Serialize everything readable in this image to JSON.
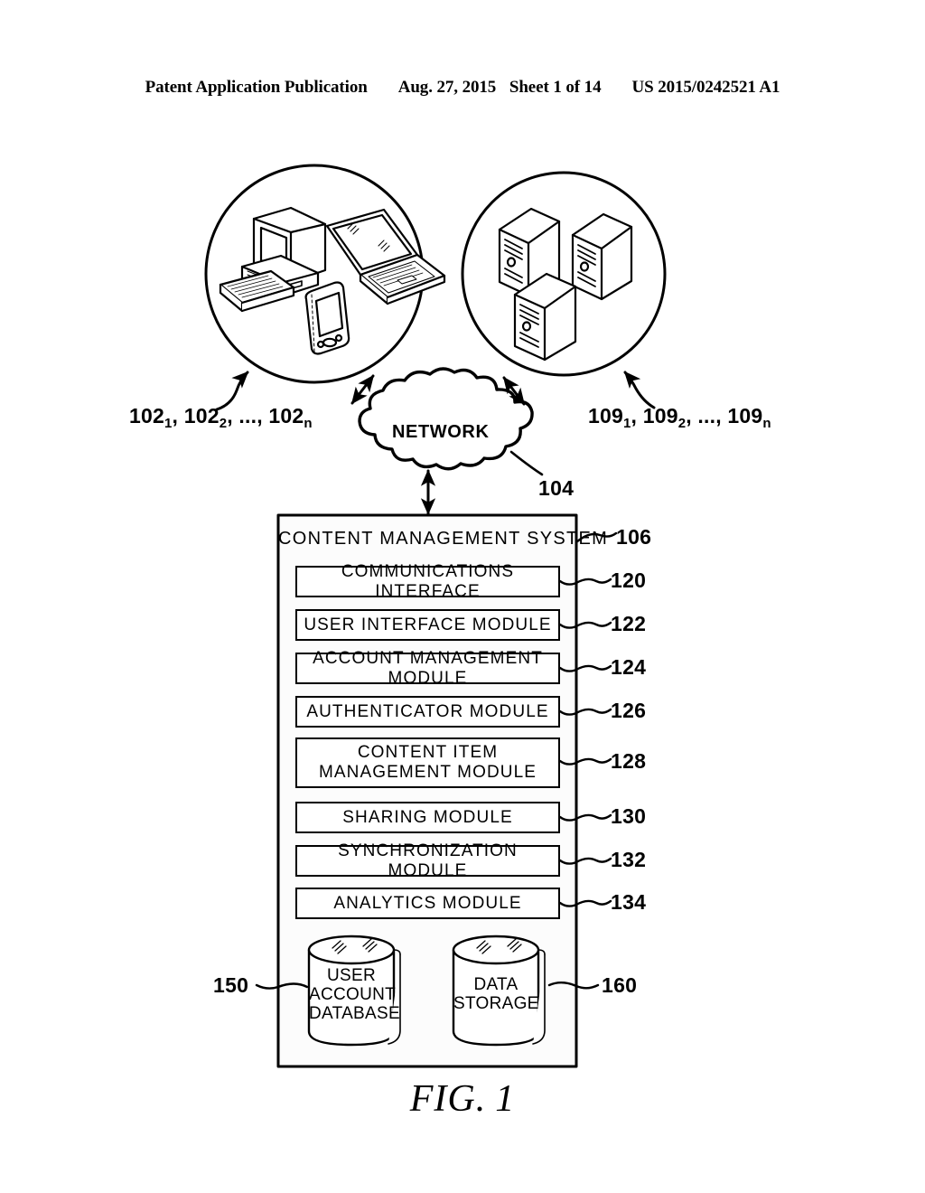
{
  "header": {
    "publication": "Patent Application Publication",
    "date": "Aug. 27, 2015",
    "sheet": "Sheet 1 of 14",
    "docnum": "US 2015/0242521 A1"
  },
  "figure": {
    "caption_prefix": "FIG.",
    "caption_number": "1",
    "client_cluster": {
      "label_base": "102",
      "label_text_1": "102",
      "label_sub_1": "1",
      "label_text_2": "102",
      "label_sub_2": "2",
      "label_ellipsis": ", ...,",
      "label_text_n": "102",
      "label_sub_n": "n",
      "devices": [
        "desktop-computer",
        "laptop-computer",
        "handheld-device"
      ]
    },
    "server_cluster": {
      "label_base": "109",
      "label_text_1": "109",
      "label_sub_1": "1",
      "label_text_2": "109",
      "label_sub_2": "2",
      "label_ellipsis": ", ...,",
      "label_text_n": "109",
      "label_sub_n": "n",
      "devices": [
        "server-tower",
        "server-tower",
        "server-tower"
      ]
    },
    "network": {
      "label": "NETWORK",
      "ref": "104"
    },
    "system": {
      "title": "CONTENT MANAGEMENT SYSTEM",
      "ref": "106",
      "modules": [
        {
          "label": "COMMUNICATIONS INTERFACE",
          "ref": "120",
          "lines": 1
        },
        {
          "label": "USER INTERFACE MODULE",
          "ref": "122",
          "lines": 1
        },
        {
          "label": "ACCOUNT MANAGEMENT MODULE",
          "ref": "124",
          "lines": 1
        },
        {
          "label": "AUTHENTICATOR MODULE",
          "ref": "126",
          "lines": 1
        },
        {
          "label": "CONTENT ITEM\nMANAGEMENT MODULE",
          "line1": "CONTENT ITEM",
          "line2": "MANAGEMENT MODULE",
          "ref": "128",
          "lines": 2
        },
        {
          "label": "SHARING MODULE",
          "ref": "130",
          "lines": 1
        },
        {
          "label": "SYNCHRONIZATION MODULE",
          "ref": "132",
          "lines": 1
        },
        {
          "label": "ANALYTICS MODULE",
          "ref": "134",
          "lines": 1
        }
      ],
      "datastores": [
        {
          "line1": "USER",
          "line2": "ACCOUNT",
          "line3": "DATABASE",
          "ref": "150",
          "ref_side": "left"
        },
        {
          "line1": "DATA",
          "line2": "STORAGE",
          "line3": "",
          "ref": "160",
          "ref_side": "right"
        }
      ]
    }
  },
  "colors": {
    "ink": "#000000",
    "paper": "#ffffff",
    "panel": "#fcfcfc"
  }
}
